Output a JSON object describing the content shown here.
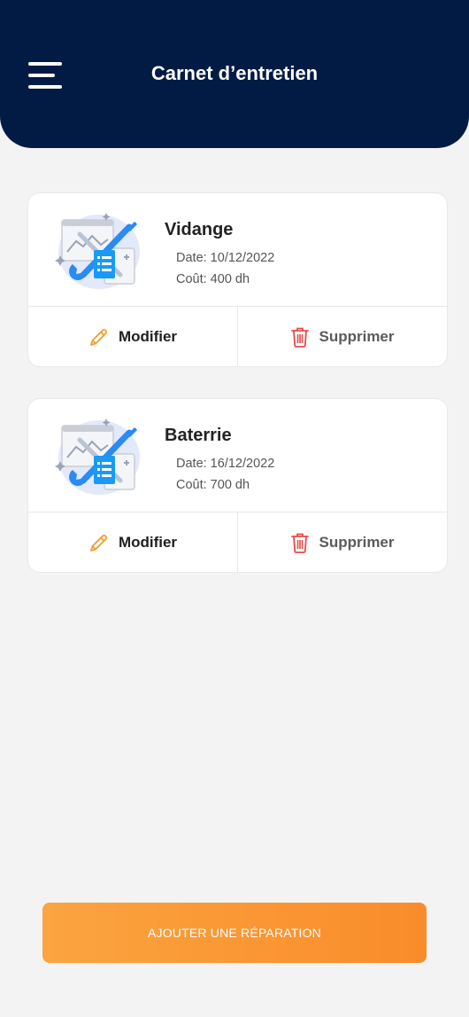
{
  "header": {
    "title": "Carnet d’entretien",
    "menu_icon": "hamburger-menu-icon",
    "background": "#011b44"
  },
  "repairs": [
    {
      "name": "Vidange",
      "date": "Date: 10/12/2022",
      "cost": "Coût: 400 dh",
      "icon": "repair-tools-illustration",
      "edit_label": "Modifier",
      "delete_label": "Supprimer"
    },
    {
      "name": "Baterrie",
      "date": "Date: 16/12/2022",
      "cost": "Coût: 700 dh",
      "icon": "repair-tools-illustration",
      "edit_label": "Modifier",
      "delete_label": "Supprimer"
    }
  ],
  "actions": {
    "edit_icon": "pencil-icon",
    "delete_icon": "trash-icon",
    "edit_color": "#f59c2c",
    "delete_color": "#e84a4a"
  },
  "add_button": {
    "label": "AJOUTER UNE RÉPARATION",
    "color": "#f98c2a"
  }
}
